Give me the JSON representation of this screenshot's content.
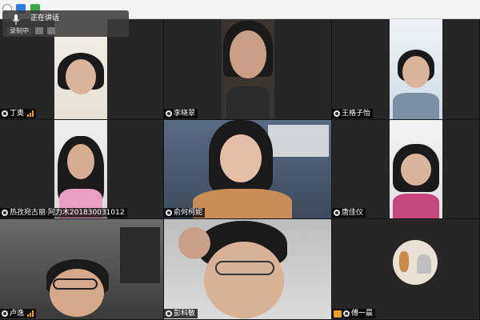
{
  "speaking_panel": {
    "label": "正在讲话",
    "rec_label": "录制中"
  },
  "participants": [
    {
      "name": "丁奥",
      "signal": true
    },
    {
      "name": "李晓翠",
      "signal": false
    },
    {
      "name": "王格子怡",
      "signal": false
    },
    {
      "name": "热孜宛古丽·阿力木201830031012",
      "signal": false
    },
    {
      "name": "俞何柯妮",
      "signal": false
    },
    {
      "name": "唐佳仪",
      "signal": false
    },
    {
      "name": "卢逸",
      "signal": true
    },
    {
      "name": "彭科敏",
      "signal": false
    },
    {
      "name": "傅一晨",
      "signal": false
    }
  ],
  "colors": {
    "accent_signal": "#f39c12",
    "mic_badge": "#f0a020"
  }
}
